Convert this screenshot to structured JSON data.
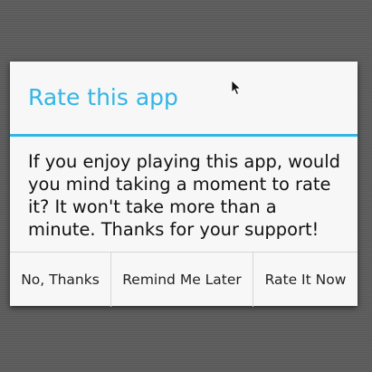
{
  "dialog": {
    "title": "Rate this app",
    "message": "If you enjoy playing this app, would you mind taking a moment to rate it? It won't take more than a minute. Thanks for your support!",
    "buttons": {
      "no_thanks": "No, Thanks",
      "remind_later": "Remind Me Later",
      "rate_now": "Rate It Now"
    }
  },
  "colors": {
    "accent": "#33b5e5",
    "background": "#5c5c5c",
    "dialog_background": "#f7f7f7",
    "text": "#111111"
  },
  "icons": {
    "cursor": "mouse-pointer-icon"
  }
}
